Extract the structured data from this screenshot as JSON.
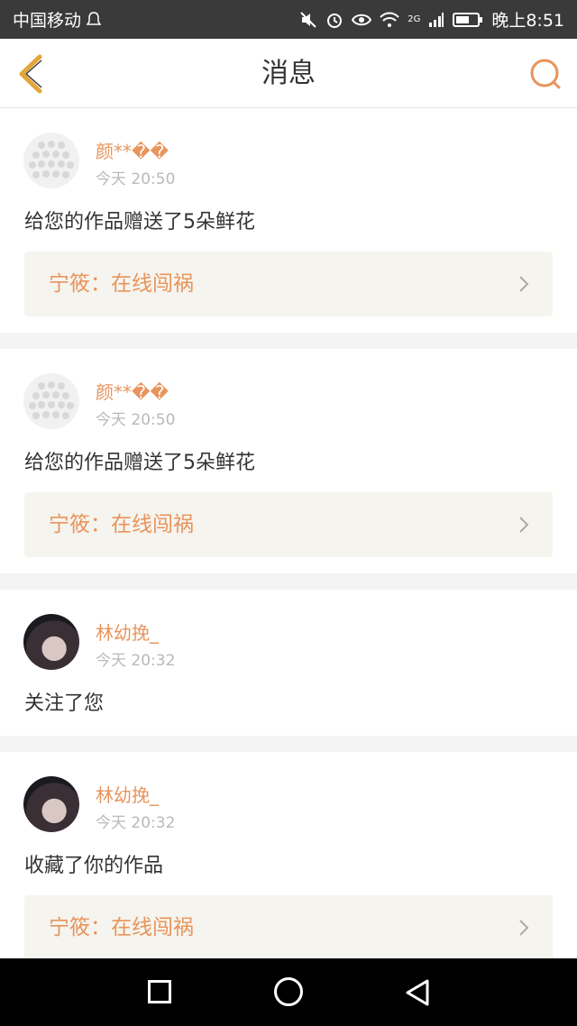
{
  "status_bar": {
    "carrier": "中国移动",
    "network": "2G",
    "time": "晚上8:51",
    "icons": [
      "bell-icon",
      "mute-icon",
      "alarm-icon",
      "eye-icon",
      "wifi-icon",
      "signal-icon",
      "battery-icon"
    ]
  },
  "header": {
    "title": "消息",
    "back_icon": "chevron-left-icon",
    "search_icon": "search-icon"
  },
  "colors": {
    "accent": "#e8945c",
    "back_arrow": "#e2a63a",
    "work_link_bg": "#f5f4ee"
  },
  "notifications": [
    {
      "username": "颜**��",
      "time": "今天 20:50",
      "message": "给您的作品赠送了5朵鲜花",
      "work_title": "宁筱：在线闯祸"
    },
    {
      "username": "颜**��",
      "time": "今天 20:50",
      "message": "给您的作品赠送了5朵鲜花",
      "work_title": "宁筱：在线闯祸"
    },
    {
      "username": "林幼挽_",
      "time": "今天 20:32",
      "message": "关注了您"
    },
    {
      "username": "林幼挽_",
      "time": "今天 20:32",
      "message": "收藏了你的作品",
      "work_title": "宁筱：在线闯祸"
    }
  ]
}
